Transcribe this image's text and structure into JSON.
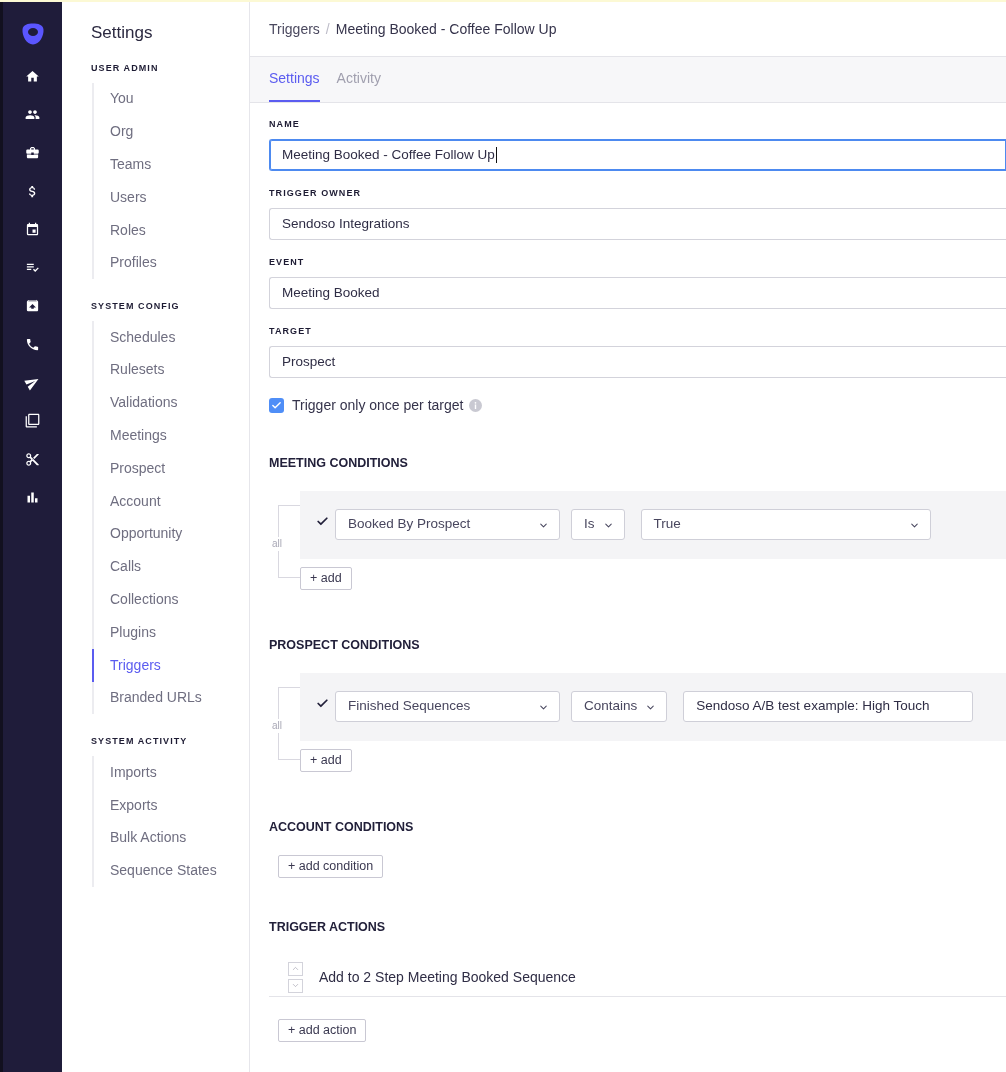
{
  "settings_sidebar": {
    "title": "Settings",
    "sections": [
      {
        "heading": "USER ADMIN",
        "items": [
          {
            "label": "You",
            "selected": false
          },
          {
            "label": "Org",
            "selected": false
          },
          {
            "label": "Teams",
            "selected": false
          },
          {
            "label": "Users",
            "selected": false
          },
          {
            "label": "Roles",
            "selected": false
          },
          {
            "label": "Profiles",
            "selected": false
          }
        ]
      },
      {
        "heading": "SYSTEM CONFIG",
        "items": [
          {
            "label": "Schedules",
            "selected": false
          },
          {
            "label": "Rulesets",
            "selected": false
          },
          {
            "label": "Validations",
            "selected": false
          },
          {
            "label": "Meetings",
            "selected": false
          },
          {
            "label": "Prospect",
            "selected": false
          },
          {
            "label": "Account",
            "selected": false
          },
          {
            "label": "Opportunity",
            "selected": false
          },
          {
            "label": "Calls",
            "selected": false
          },
          {
            "label": "Collections",
            "selected": false
          },
          {
            "label": "Plugins",
            "selected": false
          },
          {
            "label": "Triggers",
            "selected": true
          },
          {
            "label": "Branded URLs",
            "selected": false
          }
        ]
      },
      {
        "heading": "SYSTEM ACTIVITY",
        "items": [
          {
            "label": "Imports",
            "selected": false
          },
          {
            "label": "Exports",
            "selected": false
          },
          {
            "label": "Bulk Actions",
            "selected": false
          },
          {
            "label": "Sequence States",
            "selected": false
          }
        ]
      }
    ]
  },
  "breadcrumb": {
    "parent": "Triggers",
    "separator": "/",
    "current": "Meeting Booked - Coffee Follow Up"
  },
  "tabs": [
    {
      "label": "Settings",
      "selected": true
    },
    {
      "label": "Activity",
      "selected": false
    }
  ],
  "form": {
    "fields": [
      {
        "label": "NAME",
        "value": "Meeting Booked - Coffee Follow Up",
        "focused": true
      },
      {
        "label": "TRIGGER OWNER",
        "value": "Sendoso Integrations",
        "focused": false
      },
      {
        "label": "EVENT",
        "value": "Meeting Booked",
        "focused": false
      },
      {
        "label": "TARGET",
        "value": "Prospect",
        "focused": false
      }
    ],
    "checkbox": {
      "label": "Trigger only once per target",
      "checked": true
    }
  },
  "condition_groups": [
    {
      "heading": "MEETING CONDITIONS",
      "join": "all",
      "conditions": [
        {
          "kind": "select",
          "field": "Booked By Prospect",
          "operator": "Is",
          "value": "True"
        }
      ],
      "add_button": "+ add"
    },
    {
      "heading": "PROSPECT CONDITIONS",
      "join": "all",
      "conditions": [
        {
          "kind": "text",
          "field": "Finished Sequences",
          "operator": "Contains",
          "value": "Sendoso A/B test example: High Touch"
        }
      ],
      "add_button": "+ add"
    },
    {
      "heading": "ACCOUNT CONDITIONS",
      "add_button": "+ add condition"
    }
  ],
  "trigger_actions": {
    "heading": "TRIGGER ACTIONS",
    "actions": [
      {
        "label": "Add to 2 Step Meeting Booked Sequence"
      }
    ],
    "add_button": "+ add action"
  }
}
